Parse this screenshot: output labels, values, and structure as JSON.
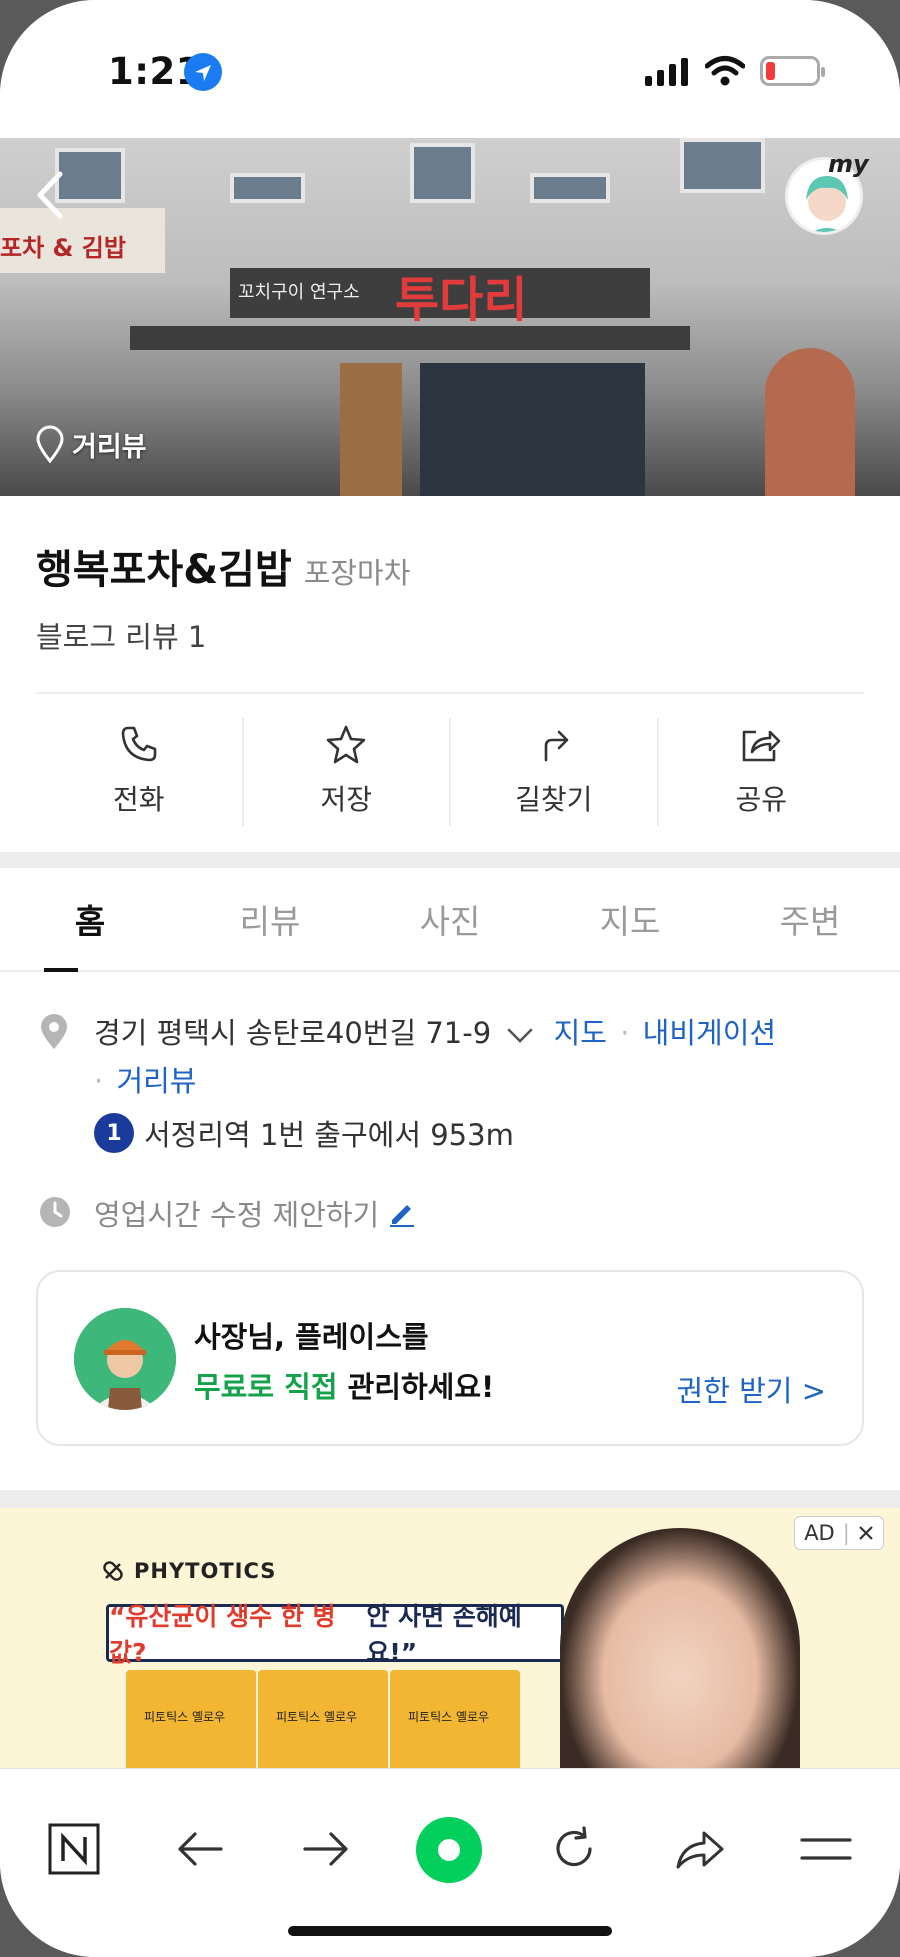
{
  "status_bar": {
    "time": "1:21"
  },
  "hero": {
    "street_view_label": "거리뷰",
    "my_label": "my",
    "sign_main": "투다리",
    "sign_small": "꼬치구이 연구소",
    "shop_left": "포차 & 김밥"
  },
  "place": {
    "name": "행복포차&김밥",
    "category": "포장마차",
    "blog_review": "블로그 리뷰 1"
  },
  "actions": [
    {
      "label": "전화",
      "icon": "phone-icon"
    },
    {
      "label": "저장",
      "icon": "star-icon"
    },
    {
      "label": "길찾기",
      "icon": "directions-icon"
    },
    {
      "label": "공유",
      "icon": "share-icon"
    }
  ],
  "tabs": [
    {
      "label": "홈",
      "active": true
    },
    {
      "label": "리뷰"
    },
    {
      "label": "사진"
    },
    {
      "label": "지도"
    },
    {
      "label": "주변"
    }
  ],
  "details": {
    "address": "경기 평택시 송탄로40번길 71-9",
    "map_link": "지도",
    "nav_link": "내비게이션",
    "street_link": "거리뷰",
    "subway_line": "1",
    "subway_text": "서정리역 1번 출구에서 953m",
    "hours_text": "영업시간 수정 제안하기"
  },
  "owner_card": {
    "line1": "사장님, 플레이스를",
    "line2_green": "무료로 직접",
    "line2_rest": " 관리하세요!",
    "link": "권한 받기 >"
  },
  "ad": {
    "badge": "AD",
    "brand": "PHYTOTICS",
    "quote_red": "“유산균이 생수 한 병 값?",
    "quote_rest": " 안 사면 손해예요!”",
    "product": "피토틱스 옐로우"
  },
  "colors": {
    "link": "#1f64c4",
    "green": "#15a24a",
    "naver_green": "#03cf5d",
    "subway_line1": "#1b3b9c"
  }
}
